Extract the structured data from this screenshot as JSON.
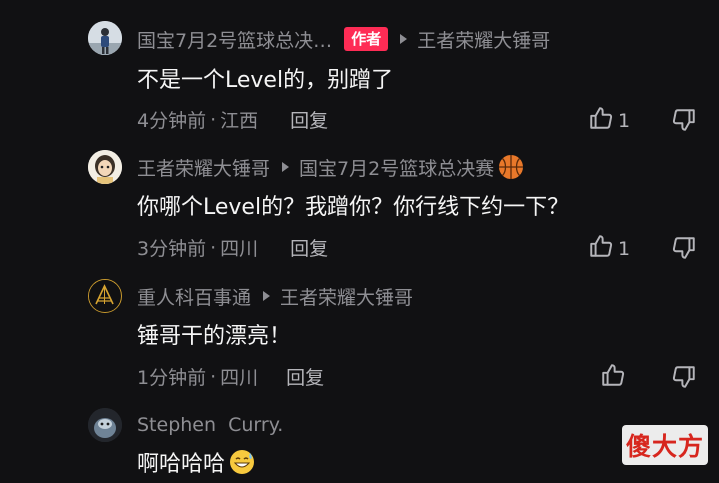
{
  "comments": [
    {
      "username": "国宝7月2号篮球总决…",
      "badge": "作者",
      "reply_to": "王者荣耀大锤哥",
      "text": "不是一个Level的，别蹭了",
      "time": "4分钟前",
      "location": "江西",
      "reply_label": "回复",
      "likes": "1"
    },
    {
      "username": "王者荣耀大锤哥",
      "reply_to": "国宝7月2号篮球总决赛",
      "text": "你哪个Level的？我蹭你？你行线下约一下？",
      "time": "3分钟前",
      "location": "四川",
      "reply_label": "回复",
      "likes": "1"
    },
    {
      "username": "重人科百事通",
      "reply_to": "王者荣耀大锤哥",
      "text": "锤哥干的漂亮！",
      "time": "1分钟前",
      "location": "四川",
      "reply_label": "回复"
    },
    {
      "username": "Stephen  Curry.",
      "text": "啊哈哈哈"
    }
  ],
  "watermark": "傻大方",
  "icons": {
    "like": "thumbs-up-icon",
    "dislike": "thumbs-down-icon",
    "basketball": "basketball-emoji-icon",
    "grin": "grinning-sweat-emoji-icon"
  },
  "colors": {
    "background": "#111113",
    "badge": "#fe2c55",
    "muted": "#8e8e93",
    "watermark": "#d7261e"
  }
}
